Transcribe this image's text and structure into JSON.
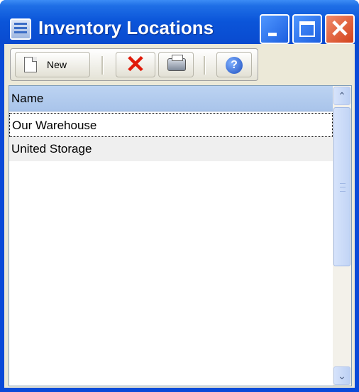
{
  "window": {
    "title": "Inventory Locations",
    "minimize_icon": "minimize-icon",
    "maximize_icon": "maximize-icon",
    "close_icon": "close-icon",
    "close_glyph": "✕"
  },
  "toolbar": {
    "new_label": "New",
    "delete_glyph": "✕",
    "help_glyph": "?"
  },
  "list": {
    "columns": [
      {
        "label": "Name"
      }
    ],
    "rows": [
      {
        "name": "Our Warehouse"
      },
      {
        "name": "United Storage"
      }
    ]
  },
  "scrollbar": {
    "up_glyph": "⌃",
    "down_glyph": "⌄"
  },
  "colors": {
    "title_bar": "#0a4ad0",
    "close_button": "#d3431c",
    "header_bg": "#bcd3f2",
    "delete_icon": "#e01a0a"
  }
}
